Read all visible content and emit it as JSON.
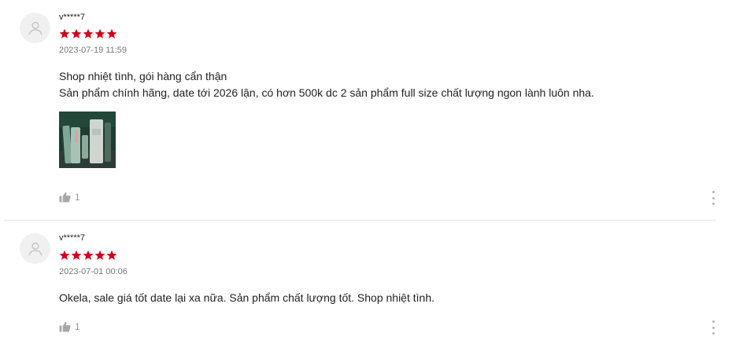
{
  "reviews": [
    {
      "username": "v*****7",
      "rating": 5,
      "timestamp": "2023-07-19 11:59",
      "comment_lines": [
        "Shop nhiệt tình, gói hàng cẩn thận",
        "Sản phẩm chính hãng, date tới 2026 lận, có hơn 500k dc 2 sản phẩm full size chất lượng ngon lành luôn nha."
      ],
      "has_photo": true,
      "likes": "1"
    },
    {
      "username": "v*****7",
      "rating": 5,
      "timestamp": "2023-07-01 00:06",
      "comment_lines": [
        "Okela, sale giá tốt date lại xa nữa. Sản phẩm chất lượng tốt. Shop nhiệt tình."
      ],
      "has_photo": false,
      "likes": "1"
    }
  ],
  "colors": {
    "star": "#d0011b",
    "avatar_bg": "#f0f0f0",
    "muted_text": "#8a8a8a"
  },
  "icons": {
    "avatar": "user-avatar-icon",
    "star": "star-icon",
    "like": "thumbs-up-icon",
    "more": "more-vertical-icon"
  }
}
